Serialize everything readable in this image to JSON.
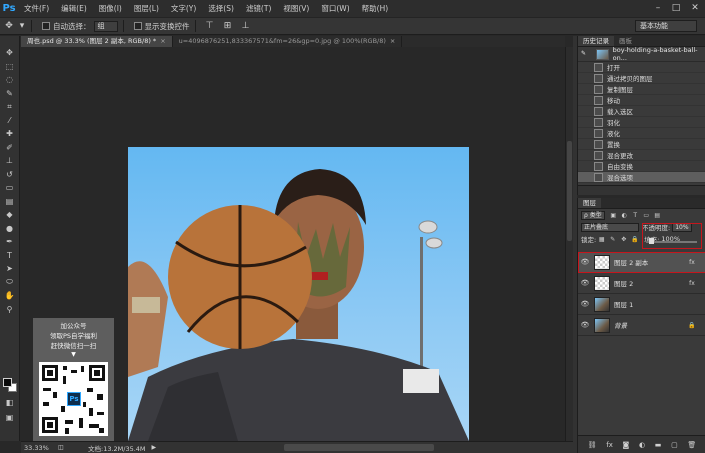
{
  "app": {
    "logo": "Ps"
  },
  "menu": [
    "文件(F)",
    "编辑(E)",
    "图像(I)",
    "图层(L)",
    "文字(Y)",
    "选择(S)",
    "滤镜(T)",
    "视图(V)",
    "窗口(W)",
    "帮助(H)"
  ],
  "window_controls": {
    "minimize": "–",
    "maximize": "□",
    "close": "✕"
  },
  "options": {
    "auto_select_label": "自动选择：",
    "auto_select_value": "组",
    "show_transform_label": "显示变换控件",
    "workspace": "基本功能"
  },
  "tabs": [
    {
      "label": "周也.psd @ 33.3% (图层 2 副本, RGB/8) *",
      "close": "×"
    },
    {
      "label": "u=4096876251,833367571&fm=26&gp=0.jpg @ 100%(RGB/8)",
      "close": "×"
    }
  ],
  "qr": {
    "line1": "加公众号",
    "line2": "领取PS自学福利",
    "line3": "赶快微信扫一扫",
    "arrow": "▼",
    "ps_label": "Ps"
  },
  "status": {
    "zoom": "33.33%",
    "doc_info": "文档:13.2M/35.4M",
    "arrow": "▶"
  },
  "history": {
    "tabs": [
      "历史记录",
      "画板"
    ],
    "snapshot_label": "boy-holding-a-basket-ball-on...",
    "items": [
      "打开",
      "通过拷贝的图层",
      "复制图层",
      "移动",
      "载入选区",
      "羽化",
      "液化",
      "置换",
      "混合更改",
      "自由变换",
      "混合选项"
    ]
  },
  "layers_panel": {
    "tabs": [
      "图层"
    ],
    "filter_kind": "ρ 类型",
    "blend_mode": "正片叠底",
    "opacity_label": "不透明度:",
    "opacity_value": "10%",
    "lock_label": "锁定:",
    "fill_label": "填充:",
    "fill_value": "100%",
    "layers": [
      {
        "name": "图层 2 副本",
        "thumb": "trans",
        "badge": "fx"
      },
      {
        "name": "图层 2",
        "thumb": "trans",
        "badge": "fx"
      },
      {
        "name": "图层 1",
        "thumb": "photo",
        "badge": ""
      },
      {
        "name": "背景",
        "thumb": "photo",
        "badge": "🔒"
      }
    ],
    "footer_icons": [
      "link-icon",
      "fx-icon",
      "mask-icon",
      "adjustment-icon",
      "folder-icon",
      "new-layer-icon",
      "trash-icon"
    ]
  },
  "colors": {
    "accent": "#31a8ff",
    "highlight_red": "#c6161d",
    "panel_bg": "#3a3a3a",
    "canvas_bg": "#282828"
  }
}
